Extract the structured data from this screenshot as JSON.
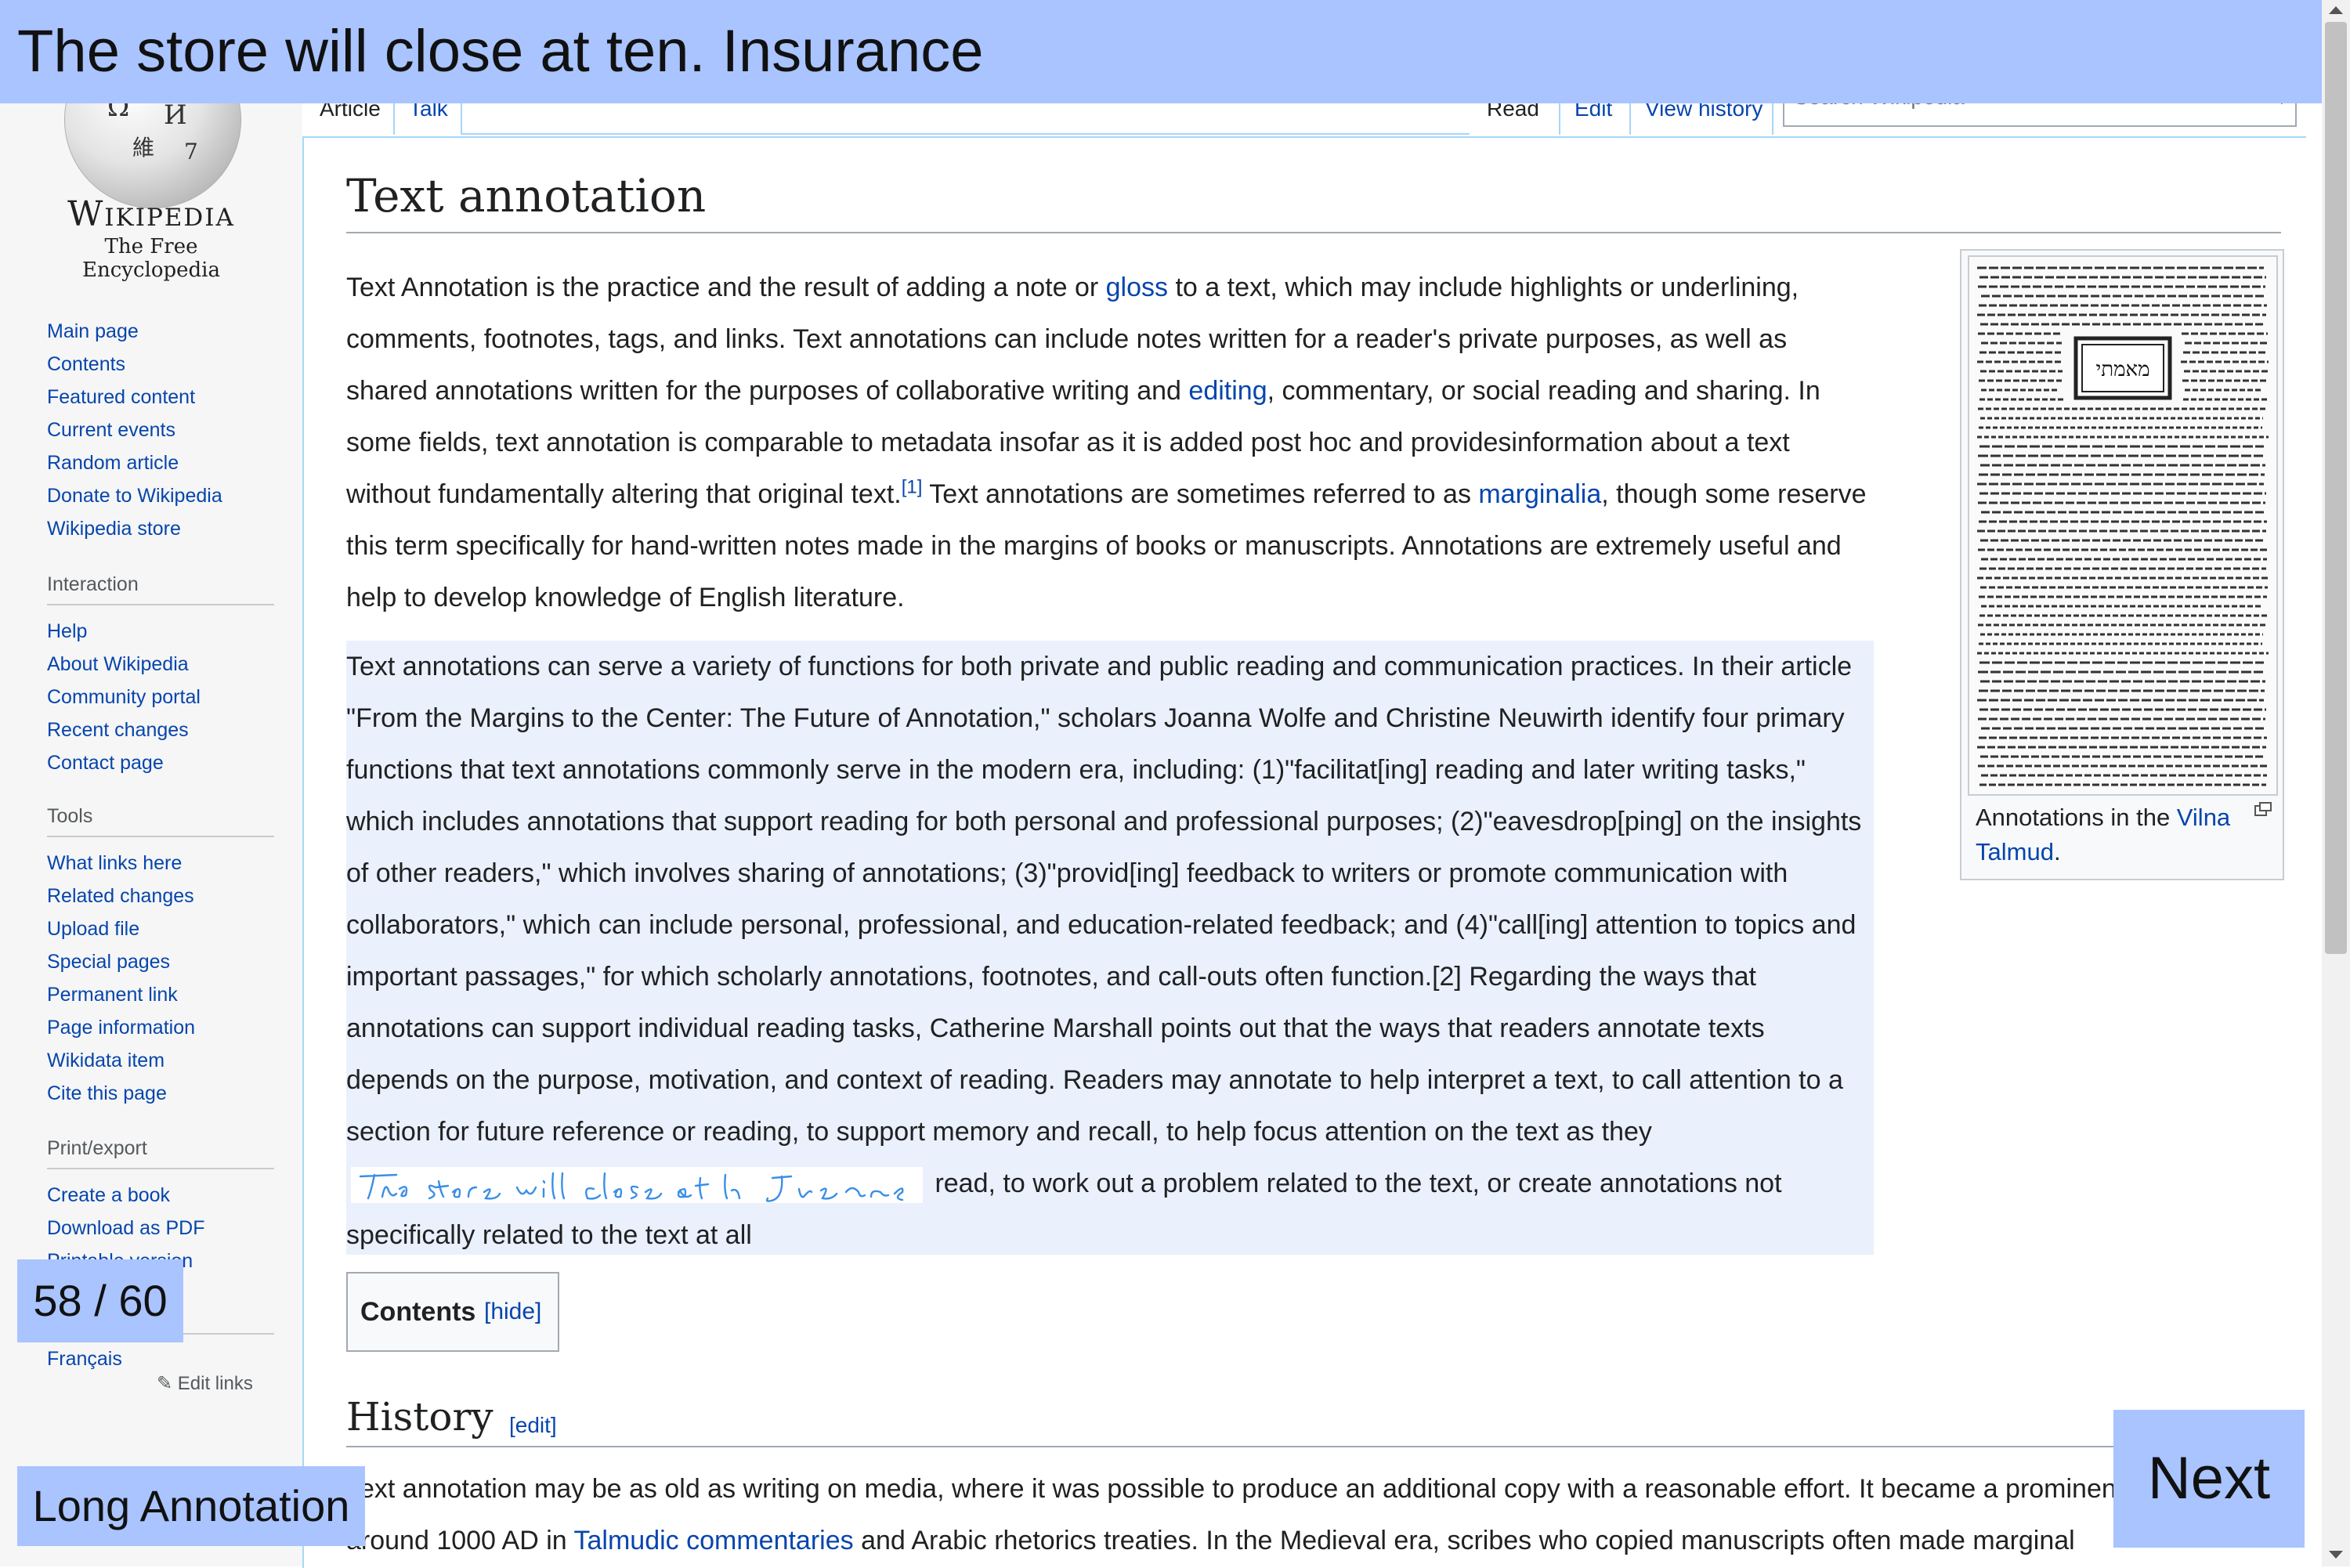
{
  "banner": {
    "text": "The store will close at ten. Insurance"
  },
  "sidebar": {
    "wordmark": "Wikipedia",
    "tagline": "The Free Encyclopedia",
    "nav": [
      "Main page",
      "Contents",
      "Featured content",
      "Current events",
      "Random article",
      "Donate to Wikipedia",
      "Wikipedia store"
    ],
    "interaction": {
      "heading": "Interaction",
      "items": [
        "Help",
        "About Wikipedia",
        "Community portal",
        "Recent changes",
        "Contact page"
      ]
    },
    "tools": {
      "heading": "Tools",
      "items": [
        "What links here",
        "Related changes",
        "Upload file",
        "Special pages",
        "Permanent link",
        "Page information",
        "Wikidata item",
        "Cite this page"
      ]
    },
    "print": {
      "heading": "Print/export",
      "items": [
        "Create a book",
        "Download as PDF",
        "Printable version"
      ]
    },
    "languages": {
      "items": [
        "Français"
      ],
      "edit_links": "Edit links"
    }
  },
  "tabs": {
    "article": "Article",
    "talk": "Talk",
    "read": "Read",
    "edit": "Edit",
    "view_history": "View history"
  },
  "search": {
    "placeholder": "Search Wikipedia"
  },
  "article": {
    "title": "Text annotation",
    "para1": {
      "t1": "Text Annotation is the practice and the result of adding a note or ",
      "link1": "gloss",
      "t2": " to a text, which may include highlights or underlining, comments, footnotes, tags, and links. Text annotations can include notes written for a reader's private purposes, as well as shared annotations written for the purposes of collaborative writing and ",
      "link2": "editing",
      "t3": ", commentary, or social reading and sharing. In some fields, text annotation is comparable to metadata insofar as it is added post hoc and providesinformation about a text without fundamentally altering that original text.",
      "ref1": "[1]",
      "t4": " Text annotations are sometimes referred to as ",
      "link3": "marginalia",
      "t5": ", though some reserve this term specifically for hand-written notes made in the margins of books or manuscripts. Annotations are extremely useful and help to develop knowledge of English literature."
    },
    "para2": {
      "t1": "Text annotations can serve a variety of functions for both private and public reading and communication practices. In their article \"From the Margins to the Center: The Future of Annotation,\" scholars Joanna Wolfe and Christine Neuwirth identify four primary functions that text annotations commonly serve in the modern era, including: (1)\"facilitat[ing] reading and later writing tasks,\" which includes annotations that support reading for both personal and professional purposes; (2)\"eavesdrop[ping] on the insights of other readers,\" which involves sharing of annotations; (3)\"provid[ing] feedback to writers or promote communication with collaborators,\" which can include personal, professional, and education-related feedback; and (4)\"call[ing] attention to topics and important passages,\" for which scholarly annotations, footnotes, and call-outs often function.[2] Regarding the ways that annotations can support individual reading tasks, Catherine Marshall points out that the ways that readers annotate texts depends on the purpose, motivation, and context of reading. Readers may annotate to help interpret a text, to call attention to a section for future reference or reading, to support memory and recall, to help focus attention on the text as they",
      "handwriting": "The store will close at ten. Insurance",
      "t2": " read, to work out a problem related to the text, or create annotations not specifically related to the text at all"
    },
    "thumb": {
      "caption_text": "Annotations in the ",
      "caption_link": "Vilna Talmud",
      "caption_end": ".",
      "image_heading": "מאמתי"
    },
    "toc": {
      "title": "Contents",
      "hide": "[hide]"
    },
    "history": {
      "heading": "History",
      "edit": "[edit]",
      "t1": "Text annotation may be as old as writing on media, where it was possible to produce an additional copy with a reasonable effort. It became a prominent activity around 1000 AD in ",
      "link1": "Talmudic commentaries",
      "t2": " and Arabic rhetorics treaties. In the Medieval era, scribes who copied manuscripts often made marginal"
    }
  },
  "overlay": {
    "counter": "58 / 60",
    "long_annotation": "Long Annotation",
    "next": "Next"
  },
  "colors": {
    "overlay": "#a9c4ff",
    "highlight": "#eaf0fc",
    "link": "#0645ad",
    "handwriting": "#3a8ee6"
  }
}
